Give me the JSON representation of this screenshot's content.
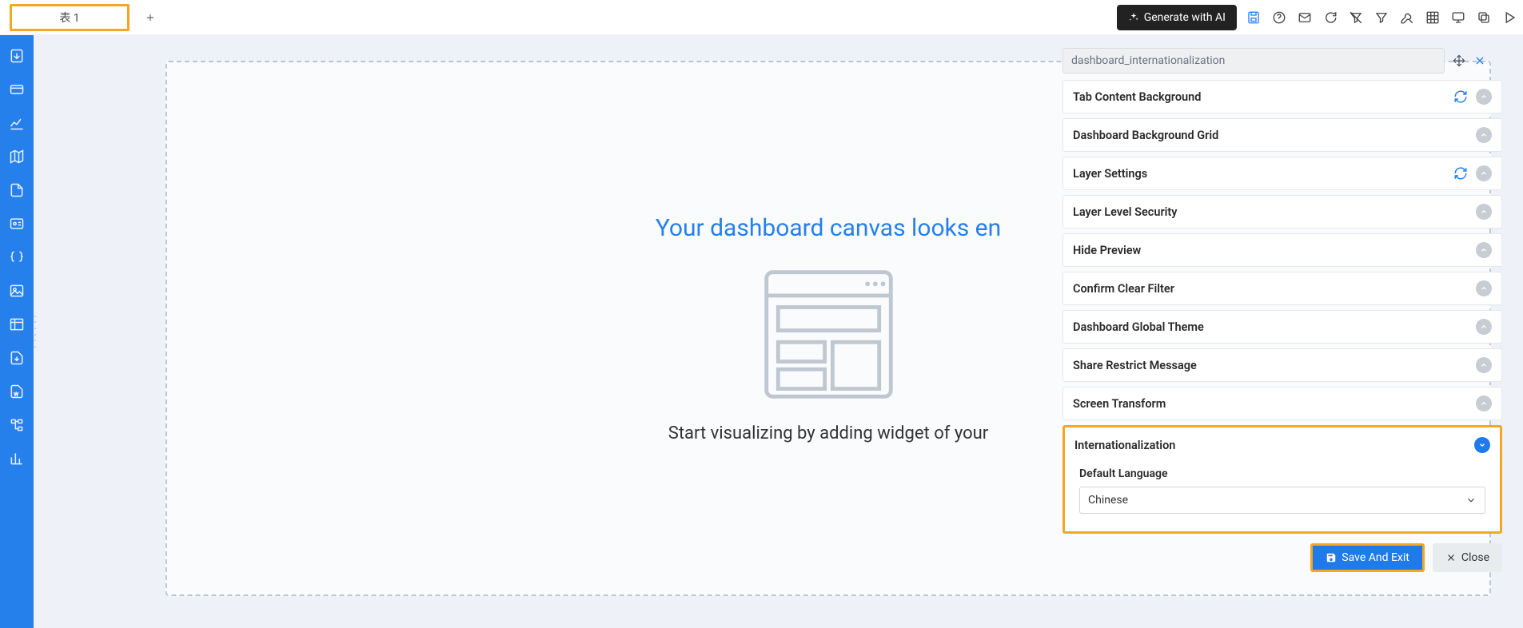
{
  "topbar": {
    "tab_label": "表 1",
    "ai_button": "Generate with AI"
  },
  "canvas": {
    "title": "Your dashboard canvas looks en",
    "subtitle": "Start visualizing by adding widget of your"
  },
  "settings": {
    "name_value": "dashboard_internationalization",
    "sections": [
      {
        "label": "Tab Content Background",
        "refresh": true
      },
      {
        "label": "Dashboard Background Grid"
      },
      {
        "label": "Layer Settings",
        "refresh": true
      },
      {
        "label": "Layer Level Security"
      },
      {
        "label": "Hide Preview"
      },
      {
        "label": "Confirm Clear Filter"
      },
      {
        "label": "Dashboard Global Theme"
      },
      {
        "label": "Share Restrict Message"
      },
      {
        "label": "Screen Transform"
      }
    ],
    "intl": {
      "title": "Internationalization",
      "default_lang_label": "Default Language",
      "default_lang_value": "Chinese"
    },
    "save_btn": "Save And Exit",
    "close_btn": "Close"
  }
}
